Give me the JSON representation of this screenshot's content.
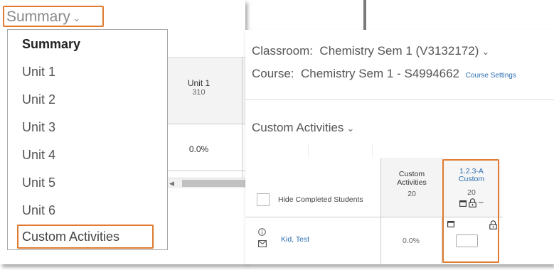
{
  "left": {
    "summary_trigger": "Summary",
    "dropdown_items": [
      {
        "label": "Summary"
      },
      {
        "label": "Unit 1"
      },
      {
        "label": "Unit 2"
      },
      {
        "label": "Unit 3"
      },
      {
        "label": "Unit 4"
      },
      {
        "label": "Unit 5"
      },
      {
        "label": "Unit 6"
      },
      {
        "label": "Custom Activities"
      }
    ],
    "grid": {
      "column_title": "Unit 1",
      "column_points": "310",
      "cell_value": "0.0%"
    }
  },
  "right": {
    "classroom_label": "Classroom:",
    "classroom_value": "Chemistry Sem 1 (V3132172)",
    "course_label": "Course:",
    "course_value": "Chemistry Sem 1 - S4994662",
    "course_settings": "Course Settings",
    "section_title": "Custom Activities",
    "hide_completed": "Hide Completed Students",
    "header_col": {
      "line1": "Custom",
      "line2": "Activities",
      "points": "20"
    },
    "activity_col": {
      "line1": "1.2.3-A",
      "line2": "Custom",
      "points": "20",
      "dash": "–"
    },
    "student": {
      "name": "Kid, Test",
      "value": "0.0%"
    }
  },
  "colors": {
    "highlight": "#e07a2e",
    "link": "#2a6eb0"
  },
  "icons": [
    "chevron-down-icon",
    "info-icon",
    "mail-icon",
    "calendar-icon",
    "lock-icon"
  ]
}
